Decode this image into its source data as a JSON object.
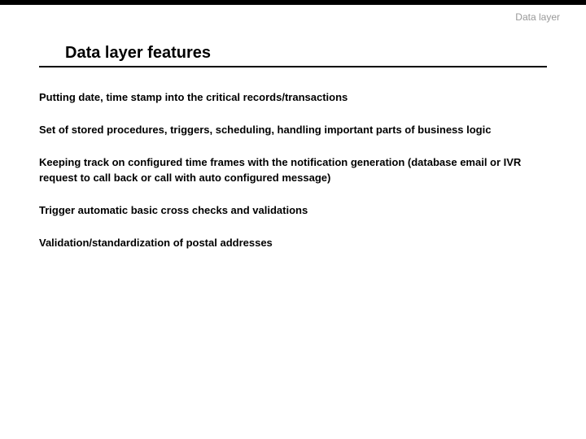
{
  "header": {
    "label": "Data layer"
  },
  "section": {
    "title": "Data layer features"
  },
  "items": [
    "Putting date, time stamp into the critical records/transactions",
    "Set of stored procedures, triggers, scheduling, handling important parts of business logic",
    "Keeping track on configured time frames with the notification generation (database email or IVR request to call back or call with auto configured message)",
    "Trigger automatic basic cross checks and validations",
    "Validation/standardization of postal addresses"
  ]
}
